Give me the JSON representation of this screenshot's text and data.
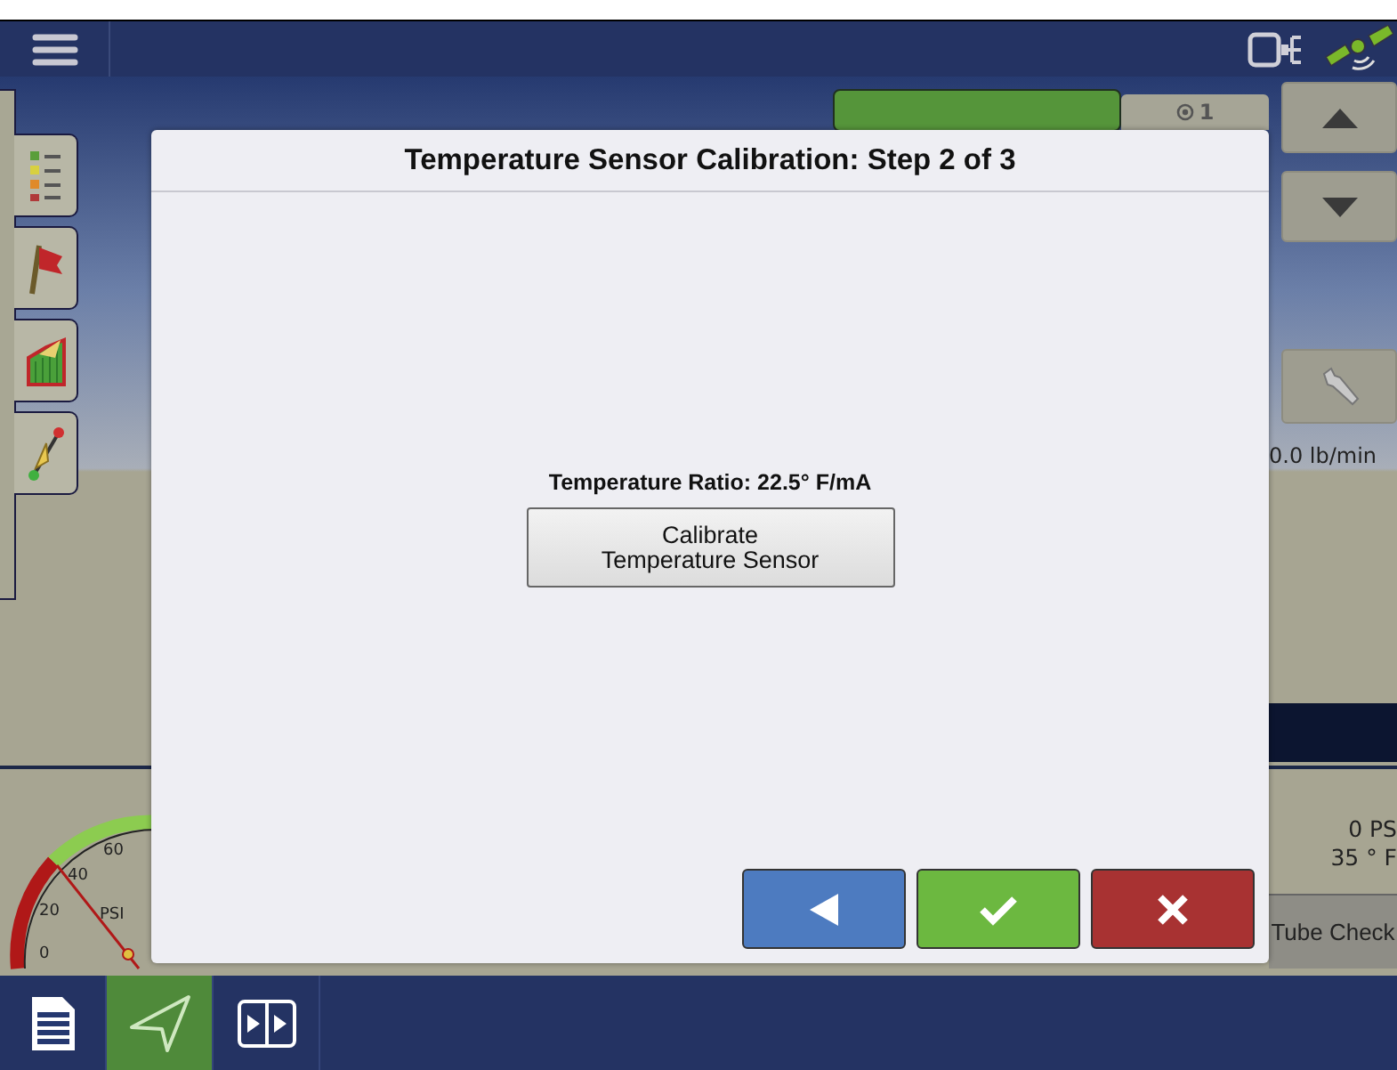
{
  "side_tabs": [
    {
      "kind": "legend",
      "selected": false
    },
    {
      "kind": "flag",
      "selected": false
    },
    {
      "kind": "chart",
      "selected": false
    },
    {
      "kind": "guidance",
      "selected": false
    }
  ],
  "right_panel": {
    "tab_label": "1",
    "reading": "0.0 lb/min"
  },
  "gauge": {
    "ticks": [
      "0",
      "20",
      "40",
      "60"
    ],
    "unit": "PSI"
  },
  "readings": [
    "0 PS",
    "35 ° F"
  ],
  "tube_check_button": "Tube Check",
  "dialog": {
    "title": "Temperature Sensor Calibration: Step 2 of 3",
    "ratio_label": "Temperature Ratio: 22.5° F/mA",
    "calibrate_button": "Calibrate\nTemperature Sensor",
    "buttons": [
      {
        "kind": "back"
      },
      {
        "kind": "confirm"
      },
      {
        "kind": "cancel"
      }
    ]
  },
  "bottom_tabs": [
    {
      "kind": "document",
      "selected": false
    },
    {
      "kind": "navigation",
      "selected": true
    },
    {
      "kind": "split-view",
      "selected": false
    }
  ]
}
